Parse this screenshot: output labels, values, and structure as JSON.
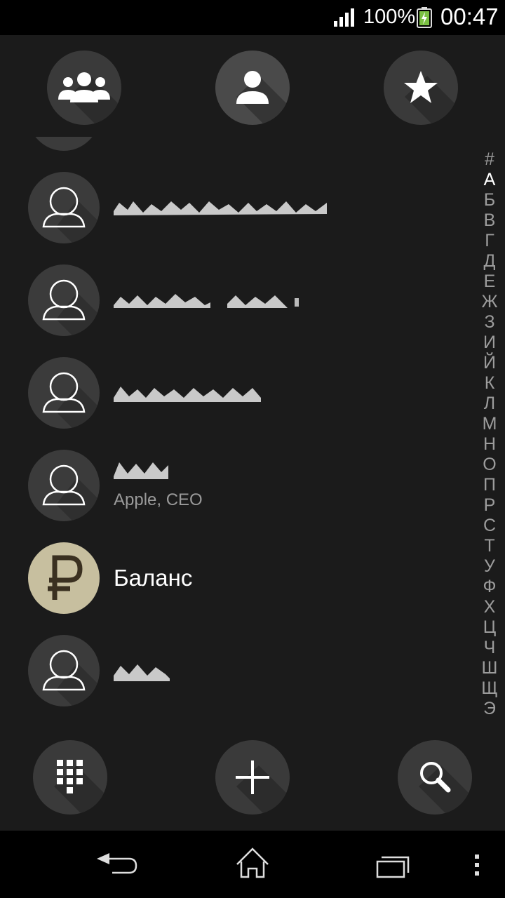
{
  "status_bar": {
    "battery_percent": "100%",
    "time": "00:47",
    "icons": [
      "signal-icon",
      "battery-charging-icon"
    ]
  },
  "top_tabs": [
    {
      "name": "groups",
      "icon": "groups-icon"
    },
    {
      "name": "contacts",
      "icon": "person-icon",
      "selected": true
    },
    {
      "name": "favorites",
      "icon": "star-icon"
    }
  ],
  "contacts": [
    {
      "name": "",
      "subtitle": "",
      "avatar": "default-avatar-icon"
    },
    {
      "name": "",
      "subtitle": "",
      "avatar": "default-avatar-icon"
    },
    {
      "name": "",
      "subtitle": "",
      "avatar": "default-avatar-icon"
    },
    {
      "name": "",
      "subtitle": "Apple, CEO",
      "avatar": "default-avatar-icon"
    },
    {
      "name": "Баланс",
      "subtitle": "",
      "avatar": "ruble-icon"
    },
    {
      "name": "",
      "subtitle": "",
      "avatar": "default-avatar-icon"
    }
  ],
  "alphabet_index": [
    "#",
    "А",
    "Б",
    "В",
    "Г",
    "Д",
    "Е",
    "Ж",
    "З",
    "И",
    "Й",
    "К",
    "Л",
    "М",
    "Н",
    "О",
    "П",
    "Р",
    "С",
    "Т",
    "У",
    "Ф",
    "Х",
    "Ц",
    "Ч",
    "Ш",
    "Щ",
    "Э"
  ],
  "alphabet_active": "А",
  "bottom_actions": [
    {
      "name": "dialpad",
      "icon": "dialpad-icon"
    },
    {
      "name": "add-contact",
      "icon": "plus-icon"
    },
    {
      "name": "search",
      "icon": "search-icon"
    }
  ],
  "nav_bar": {
    "icons": [
      "back-icon",
      "home-icon",
      "recents-icon",
      "menu-icon"
    ]
  },
  "colors": {
    "background": "#1b1b1b",
    "circle": "#3a3a3a",
    "ruble_avatar": "#c7bf9f",
    "index_text": "#9c9c9c"
  }
}
